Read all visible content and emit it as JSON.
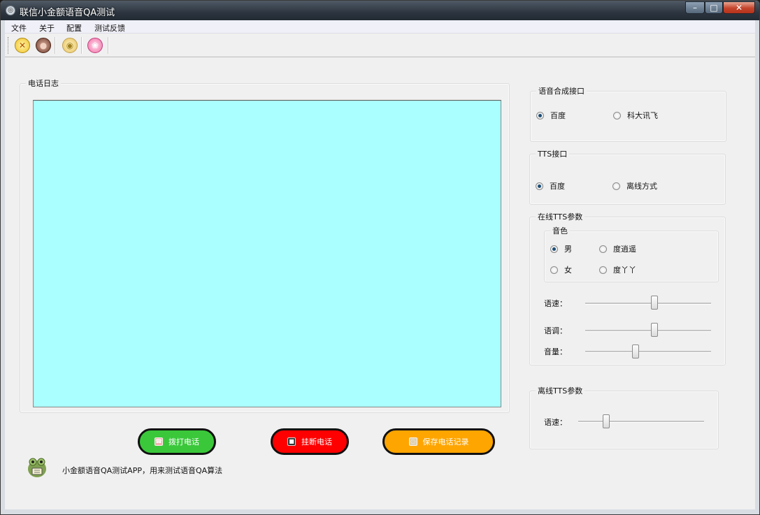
{
  "window": {
    "title": "联信小金额语音QA测试",
    "min": "–",
    "max": "□",
    "close": "✕"
  },
  "menu": [
    "文件",
    "关于",
    "配置",
    "测试反馈"
  ],
  "toolbar": {
    "icons": [
      "close-circle-icon",
      "record-icon",
      "coin-icon",
      "pink-chat-icon"
    ]
  },
  "log": {
    "label": "电话日志",
    "content": "",
    "background": "#aaffff"
  },
  "tts_synth": {
    "label": "语音合成接口",
    "options": [
      "百度",
      "科大讯飞"
    ],
    "selected": "百度"
  },
  "tts_api": {
    "label": "TTS接口",
    "options": [
      "百度",
      "离线方式"
    ],
    "selected": "百度"
  },
  "online_params": {
    "label": "在线TTS参数",
    "voice": {
      "label": "音色",
      "options": [
        "男",
        "度逍遥",
        "女",
        "度丫丫"
      ],
      "selected": "男"
    },
    "speed": {
      "label": "语速：",
      "value": 0.55
    },
    "pitch": {
      "label": "语调：",
      "value": 0.55
    },
    "volume": {
      "label": "音量：",
      "value": 0.4
    }
  },
  "offline_params": {
    "label": "离线TTS参数",
    "speed": {
      "label": "语速：",
      "value": 0.22
    }
  },
  "buttons": {
    "dial": {
      "label": "拨打电话",
      "color": "#3ac83a"
    },
    "hangup": {
      "label": "挂断电话",
      "color": "#ff0000"
    },
    "save": {
      "label": "保存电话记录",
      "color": "#ffa500"
    }
  },
  "footer": "小金额语音QA测试APP，用来测试语音QA算法"
}
